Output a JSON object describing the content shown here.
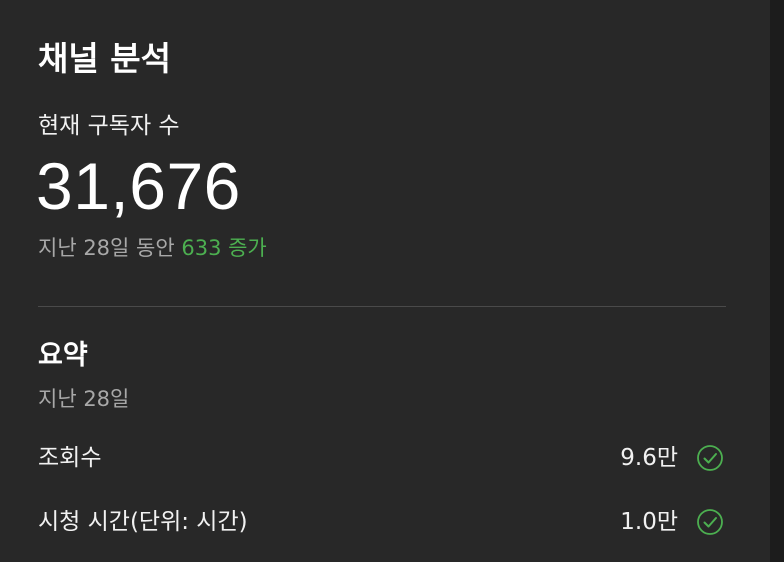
{
  "header": {
    "title": "채널 분석"
  },
  "subscribers": {
    "label": "현재 구독자 수",
    "count": "31,676",
    "period": "지난 28일 동안",
    "change": "633 증가",
    "change_color": "#4caf50"
  },
  "summary": {
    "title": "요약",
    "period": "지난 28일",
    "metrics": [
      {
        "label": "조회수",
        "value": "9.6만",
        "icon": "check-circle-icon"
      },
      {
        "label": "시청 시간(단위: 시간)",
        "value": "1.0만",
        "icon": "check-circle-icon"
      }
    ],
    "icon_color": "#4caf50"
  }
}
